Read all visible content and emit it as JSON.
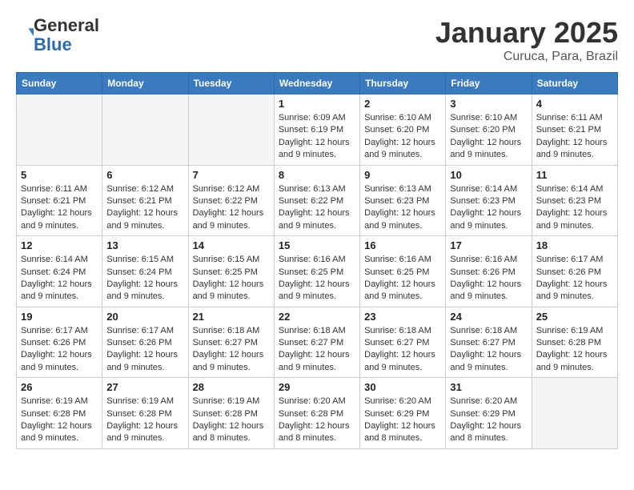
{
  "header": {
    "logo_general": "General",
    "logo_blue": "Blue",
    "month": "January 2025",
    "location": "Curuca, Para, Brazil"
  },
  "weekdays": [
    "Sunday",
    "Monday",
    "Tuesday",
    "Wednesday",
    "Thursday",
    "Friday",
    "Saturday"
  ],
  "weeks": [
    [
      {
        "day": "",
        "info": ""
      },
      {
        "day": "",
        "info": ""
      },
      {
        "day": "",
        "info": ""
      },
      {
        "day": "1",
        "info": "Sunrise: 6:09 AM\nSunset: 6:19 PM\nDaylight: 12 hours and 9 minutes."
      },
      {
        "day": "2",
        "info": "Sunrise: 6:10 AM\nSunset: 6:20 PM\nDaylight: 12 hours and 9 minutes."
      },
      {
        "day": "3",
        "info": "Sunrise: 6:10 AM\nSunset: 6:20 PM\nDaylight: 12 hours and 9 minutes."
      },
      {
        "day": "4",
        "info": "Sunrise: 6:11 AM\nSunset: 6:21 PM\nDaylight: 12 hours and 9 minutes."
      }
    ],
    [
      {
        "day": "5",
        "info": "Sunrise: 6:11 AM\nSunset: 6:21 PM\nDaylight: 12 hours and 9 minutes."
      },
      {
        "day": "6",
        "info": "Sunrise: 6:12 AM\nSunset: 6:21 PM\nDaylight: 12 hours and 9 minutes."
      },
      {
        "day": "7",
        "info": "Sunrise: 6:12 AM\nSunset: 6:22 PM\nDaylight: 12 hours and 9 minutes."
      },
      {
        "day": "8",
        "info": "Sunrise: 6:13 AM\nSunset: 6:22 PM\nDaylight: 12 hours and 9 minutes."
      },
      {
        "day": "9",
        "info": "Sunrise: 6:13 AM\nSunset: 6:23 PM\nDaylight: 12 hours and 9 minutes."
      },
      {
        "day": "10",
        "info": "Sunrise: 6:14 AM\nSunset: 6:23 PM\nDaylight: 12 hours and 9 minutes."
      },
      {
        "day": "11",
        "info": "Sunrise: 6:14 AM\nSunset: 6:23 PM\nDaylight: 12 hours and 9 minutes."
      }
    ],
    [
      {
        "day": "12",
        "info": "Sunrise: 6:14 AM\nSunset: 6:24 PM\nDaylight: 12 hours and 9 minutes."
      },
      {
        "day": "13",
        "info": "Sunrise: 6:15 AM\nSunset: 6:24 PM\nDaylight: 12 hours and 9 minutes."
      },
      {
        "day": "14",
        "info": "Sunrise: 6:15 AM\nSunset: 6:25 PM\nDaylight: 12 hours and 9 minutes."
      },
      {
        "day": "15",
        "info": "Sunrise: 6:16 AM\nSunset: 6:25 PM\nDaylight: 12 hours and 9 minutes."
      },
      {
        "day": "16",
        "info": "Sunrise: 6:16 AM\nSunset: 6:25 PM\nDaylight: 12 hours and 9 minutes."
      },
      {
        "day": "17",
        "info": "Sunrise: 6:16 AM\nSunset: 6:26 PM\nDaylight: 12 hours and 9 minutes."
      },
      {
        "day": "18",
        "info": "Sunrise: 6:17 AM\nSunset: 6:26 PM\nDaylight: 12 hours and 9 minutes."
      }
    ],
    [
      {
        "day": "19",
        "info": "Sunrise: 6:17 AM\nSunset: 6:26 PM\nDaylight: 12 hours and 9 minutes."
      },
      {
        "day": "20",
        "info": "Sunrise: 6:17 AM\nSunset: 6:26 PM\nDaylight: 12 hours and 9 minutes."
      },
      {
        "day": "21",
        "info": "Sunrise: 6:18 AM\nSunset: 6:27 PM\nDaylight: 12 hours and 9 minutes."
      },
      {
        "day": "22",
        "info": "Sunrise: 6:18 AM\nSunset: 6:27 PM\nDaylight: 12 hours and 9 minutes."
      },
      {
        "day": "23",
        "info": "Sunrise: 6:18 AM\nSunset: 6:27 PM\nDaylight: 12 hours and 9 minutes."
      },
      {
        "day": "24",
        "info": "Sunrise: 6:18 AM\nSunset: 6:27 PM\nDaylight: 12 hours and 9 minutes."
      },
      {
        "day": "25",
        "info": "Sunrise: 6:19 AM\nSunset: 6:28 PM\nDaylight: 12 hours and 9 minutes."
      }
    ],
    [
      {
        "day": "26",
        "info": "Sunrise: 6:19 AM\nSunset: 6:28 PM\nDaylight: 12 hours and 9 minutes."
      },
      {
        "day": "27",
        "info": "Sunrise: 6:19 AM\nSunset: 6:28 PM\nDaylight: 12 hours and 9 minutes."
      },
      {
        "day": "28",
        "info": "Sunrise: 6:19 AM\nSunset: 6:28 PM\nDaylight: 12 hours and 8 minutes."
      },
      {
        "day": "29",
        "info": "Sunrise: 6:20 AM\nSunset: 6:28 PM\nDaylight: 12 hours and 8 minutes."
      },
      {
        "day": "30",
        "info": "Sunrise: 6:20 AM\nSunset: 6:29 PM\nDaylight: 12 hours and 8 minutes."
      },
      {
        "day": "31",
        "info": "Sunrise: 6:20 AM\nSunset: 6:29 PM\nDaylight: 12 hours and 8 minutes."
      },
      {
        "day": "",
        "info": ""
      }
    ]
  ]
}
